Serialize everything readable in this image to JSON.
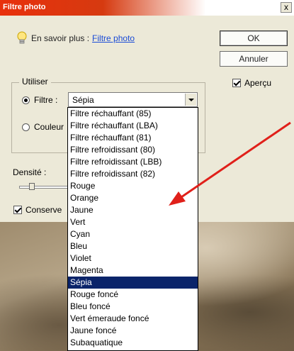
{
  "window": {
    "title": "Filtre photo",
    "close_symbol": "x"
  },
  "help": {
    "prefix": "En savoir plus :",
    "link": "Filtre photo"
  },
  "buttons": {
    "ok": "OK",
    "cancel": "Annuler"
  },
  "preview": {
    "label": "Aperçu",
    "checked": true
  },
  "use_group": {
    "legend": "Utiliser",
    "filter_label": "Filtre :",
    "color_label": "Couleur",
    "filter_selected": true,
    "filter_value": "Sépia"
  },
  "density": {
    "label": "Densité :",
    "level_percent": 25
  },
  "preserve": {
    "label": "Conserve",
    "checked": true
  },
  "dropdown": {
    "selected": "Sépia",
    "options": [
      "Filtre réchauffant (85)",
      "Filtre réchauffant (LBA)",
      "Filtre réchauffant (81)",
      "Filtre refroidissant (80)",
      "Filtre refroidissant (LBB)",
      "Filtre refroidissant (82)",
      "Rouge",
      "Orange",
      "Jaune",
      "Vert",
      "Cyan",
      "Bleu",
      "Violet",
      "Magenta",
      "Sépia",
      "Rouge foncé",
      "Bleu foncé",
      "Vert émeraude foncé",
      "Jaune foncé",
      "Subaquatique"
    ]
  },
  "colors": {
    "title_bar": "#e8300c",
    "selection": "#0a246a",
    "link": "#1a4bd6",
    "annotation_arrow": "#e0201a"
  },
  "icons": {
    "help": "lightbulb-icon",
    "annotation": "red-arrow-icon"
  }
}
